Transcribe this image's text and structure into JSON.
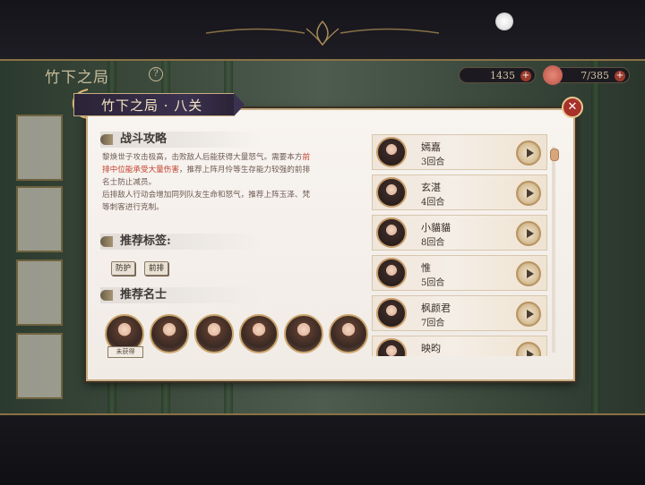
{
  "background": {
    "title": "竹下之局",
    "help_icon": "question-icon",
    "resources": [
      {
        "value": "1435",
        "icon": "jade-icon"
      },
      {
        "value": "7/385",
        "icon": "flower-icon"
      }
    ]
  },
  "panel": {
    "title": "竹下之局 · 八关",
    "close_icon": "close-icon",
    "strategy": {
      "heading": "战斗攻略",
      "line1": "黎焕世子攻击极高，击败敌人后能获得大量怒气。需要本方",
      "line1_hl": "前",
      "line2_hl": "排中位能承受大量伤害",
      "line2": "，推荐上阵月伶等生存能力较强的前排",
      "line3": "名士防止减员。",
      "line4": "后排敌人行动会增加同列队友生命和怒气，推荐上阵玉泽、梵",
      "line5": "等刺客进行克制。"
    },
    "tags": {
      "heading": "推荐标签:",
      "items": [
        "防护",
        "前排"
      ]
    },
    "heroes": {
      "heading": "推荐名士",
      "owned_flag": "未获得",
      "count": 6
    }
  },
  "records": [
    {
      "name": "嫣嘉",
      "rounds": "3回合"
    },
    {
      "name": "玄湛",
      "rounds": "4回合"
    },
    {
      "name": "小貓貓",
      "rounds": "8回合"
    },
    {
      "name": "惟",
      "rounds": "5回合"
    },
    {
      "name": "枫颜君",
      "rounds": "7回合"
    },
    {
      "name": "映昀",
      "rounds": ""
    }
  ],
  "colors": {
    "accent": "#c7ad83",
    "highlight": "#c2402b",
    "banner": "#3b3150",
    "close": "#a8312a"
  }
}
